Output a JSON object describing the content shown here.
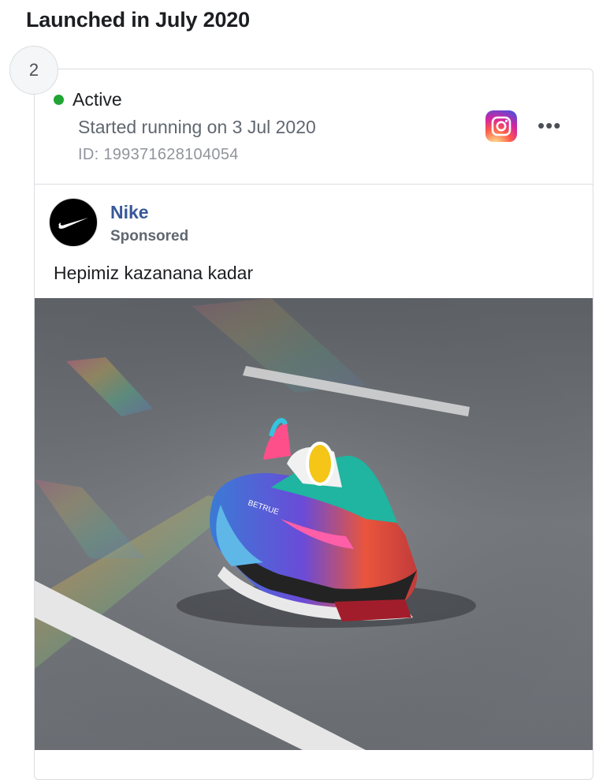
{
  "section": {
    "title": "Launched in July 2020"
  },
  "ad": {
    "rank": "2",
    "status": "Active",
    "status_color": "#1fa533",
    "started": "Started running on 3 Jul 2020",
    "id_text": "ID: 199371628104054",
    "platform_icon": "instagram-icon",
    "more_icon": "more-options-icon",
    "more_glyph": "•••",
    "page_name": "Nike",
    "page_name_color": "#385898",
    "sponsored": "Sponsored",
    "body_text": "Hepimiz kazanana kadar",
    "creative_icon": "sneaker-photo",
    "shoe_text": "BETRUE"
  }
}
